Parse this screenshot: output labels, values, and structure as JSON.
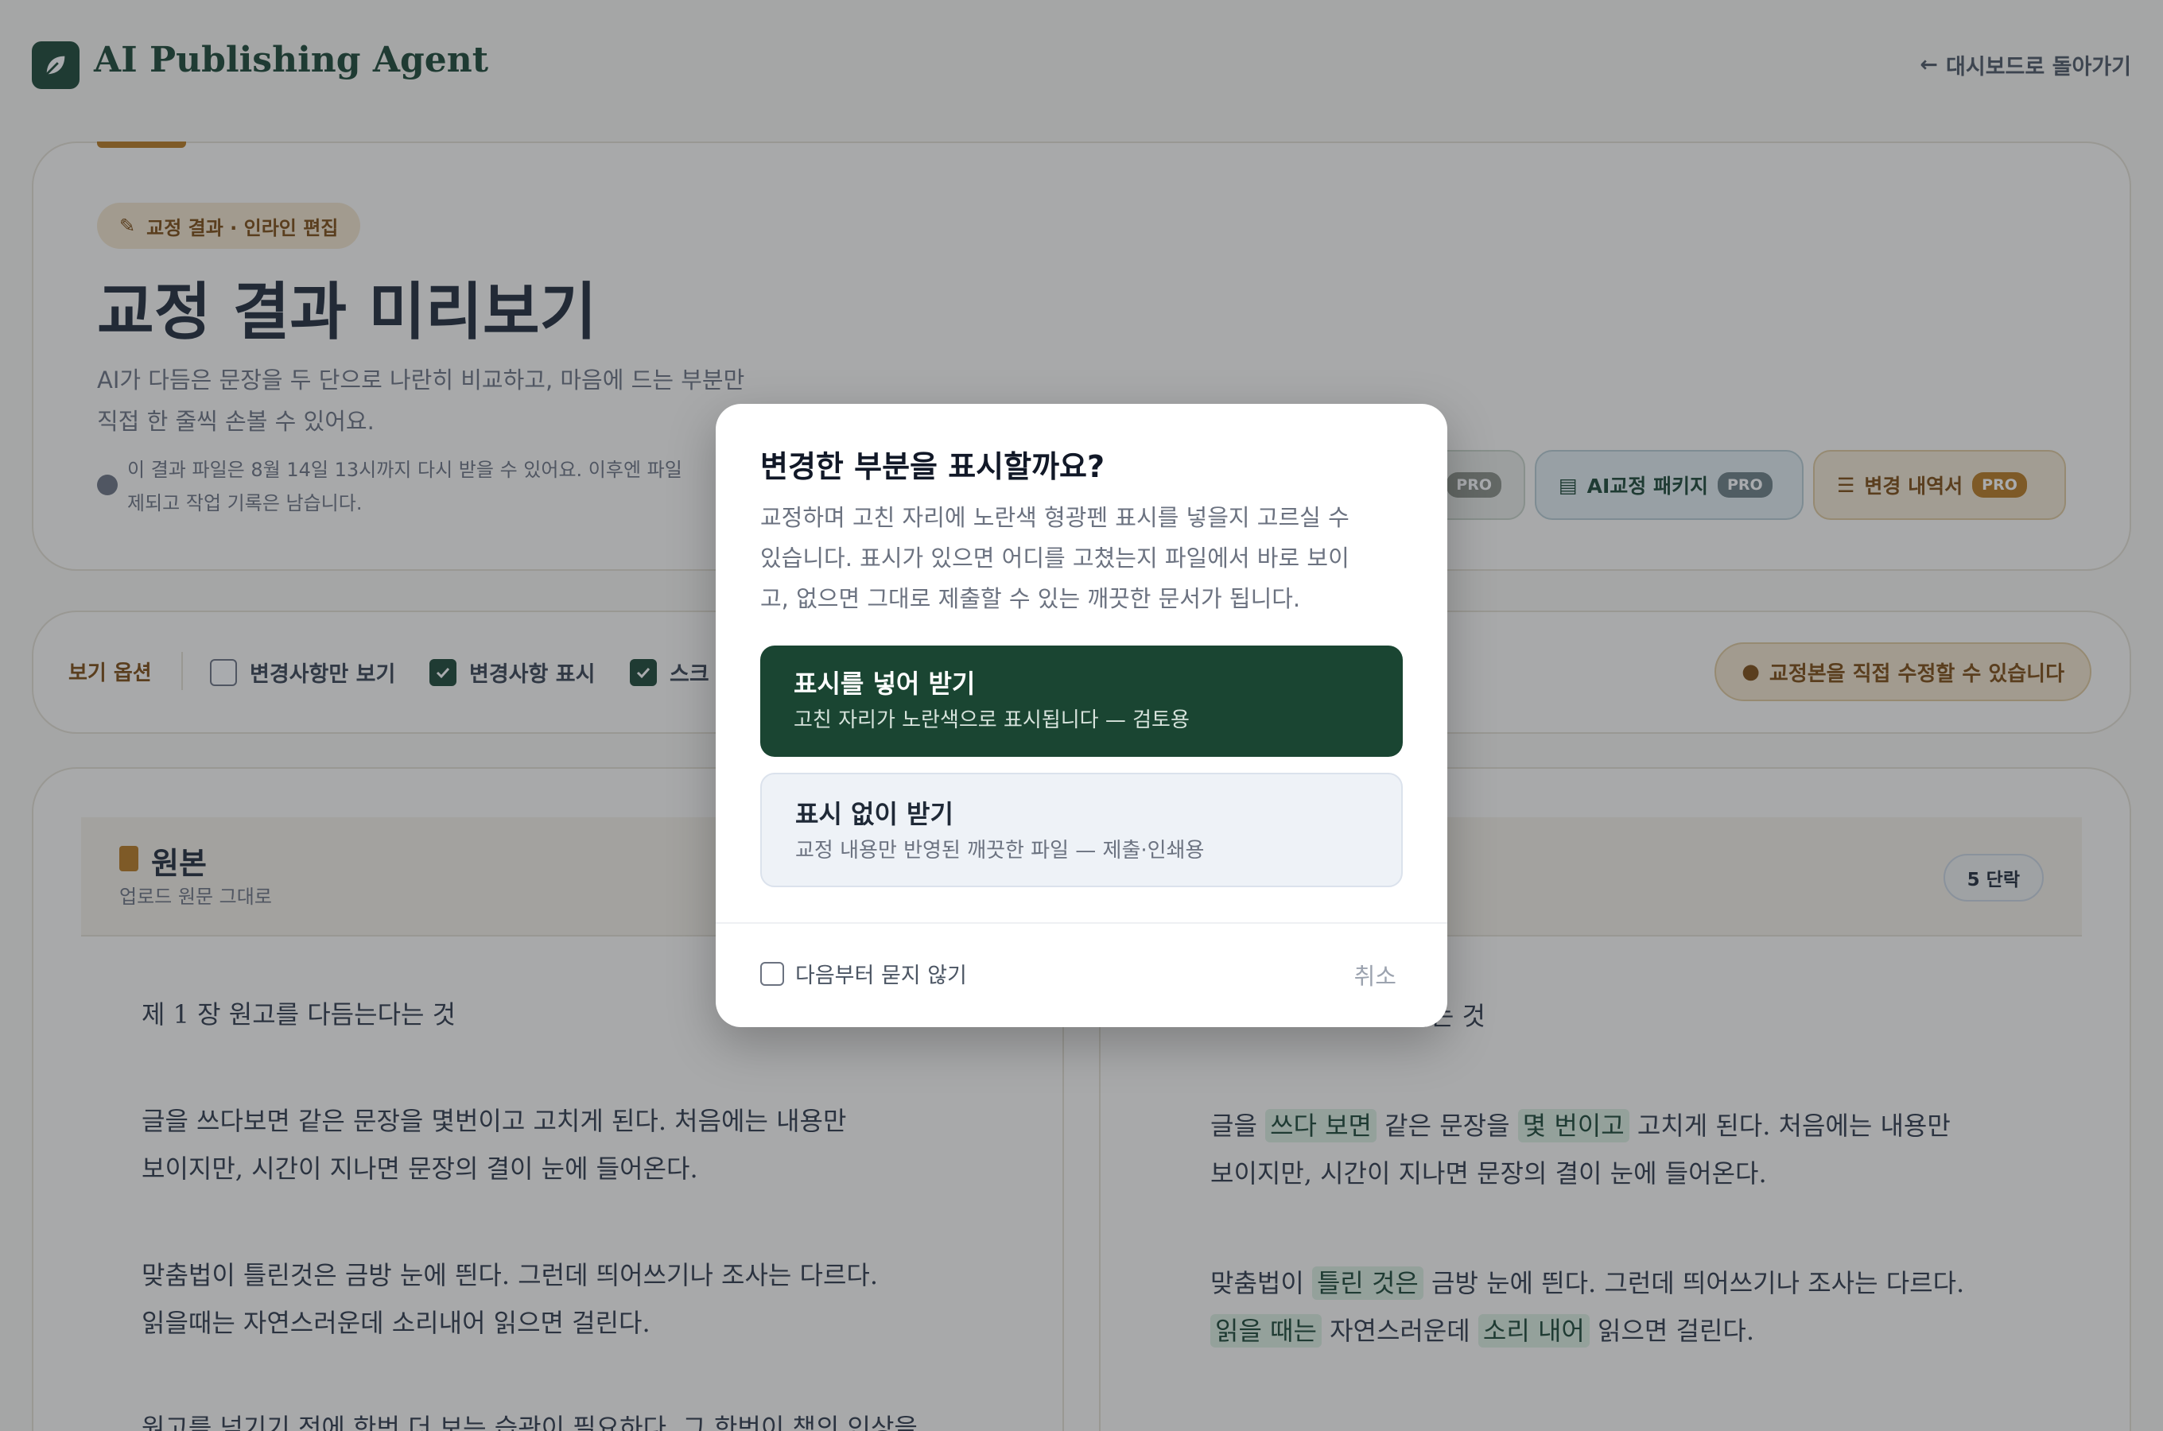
{
  "app": {
    "title": "AI Publishing Agent",
    "back_label": "대시보드로 돌아가기"
  },
  "hero": {
    "badge": "교정 결과 · 인라인 편집",
    "title": "교정 결과 미리보기",
    "desc_line1": "AI가 다듬은 문장을 두 단으로 나란히 비교하고, 마음에 드는 부분만",
    "desc_line2": "직접 한 줄씩 손볼 수 있어요.",
    "note_line1": "이 결과 파일은 8월 14일 13시까지 다시 받을 수 있어요. 이후엔 파일",
    "note_line2": "제되고 작업 기록은 남습니다.",
    "actions": [
      {
        "label": "",
        "pro": "PRO"
      },
      {
        "label": "AI교정 패키지",
        "pro": "PRO"
      },
      {
        "label": "변경 내역서",
        "pro": "PRO"
      }
    ]
  },
  "view_options": {
    "label": "보기 옵션",
    "changes_only": "변경사항만 보기",
    "show_changes": "변경사항 표시",
    "scroll": "스크",
    "tip": "교정본을 직접 수정할 수 있습니다"
  },
  "original": {
    "title": "원본",
    "subtitle": "업로드 원문 그대로",
    "para_count": "5 단락"
  },
  "original_text": {
    "heading": "제 1 장  원고를 다듬는다는 것",
    "p1_l1": "글을 쓰다보면 같은 문장을 몇번이고 고치게 된다. 처음에는 내용만",
    "p1_l2": "보이지만, 시간이 지나면 문장의 결이 눈에 들어온다.",
    "p2_l1": "맞춤법이 틀린것은 금방 눈에 띈다. 그런데 띄어쓰기나 조사는 다르다.",
    "p2_l2": "읽을때는 자연스러운데 소리내어 읽으면 걸린다.",
    "p3_l1": "원고를 넘기기 전에 한번 더 보는 습관이 필요하다. 그 한번이 책의 인상을"
  },
  "corrected_text": {
    "heading_end": "는다는 것",
    "p1_a": "글을 ",
    "p1_h1": "쓰다 보면",
    "p1_b": " 같은 문장을 ",
    "p1_h2": "몇 번이고",
    "p1_c": " 고치게 된다. 처음에는 내용만",
    "p1_l2": "보이지만, 시간이 지나면 문장의 결이 눈에 들어온다.",
    "p2_a": "맞춤법이 ",
    "p2_h1": "틀린 것은",
    "p2_b": " 금방 눈에 띈다. 그런데 띄어쓰기나 조사는 다르다.",
    "p2_h2": "읽을 때는",
    "p2_c": " 자연스러운데 ",
    "p2_h3": "소리 내어",
    "p2_d": " 읽으면 걸린다."
  },
  "modal": {
    "title": "변경한 부분을 표시할까요?",
    "body_l1": "교정하며 고친 자리에 노란색 형광펜 표시를 넣을지 고르실 수",
    "body_l2": "있습니다. 표시가 있으면 어디를 고쳤는지 파일에서 바로 보이",
    "body_l3": "고, 없으면 그대로 제출할 수 있는 깨끗한 문서가 됩니다.",
    "primary": {
      "title": "표시를 넣어 받기",
      "sub": "고친 자리가 노란색으로 표시됩니다 — 검토용"
    },
    "secondary": {
      "title": "표시 없이 받기",
      "sub": "교정 내용만 반영된 깨끗한 파일 — 제출·인쇄용"
    },
    "dont_ask": "다음부터 묻지 않기",
    "cancel": "취소"
  },
  "colors": {
    "brand": "#1a4532",
    "accent": "#b7791f",
    "highlight": "#dcefe0"
  }
}
